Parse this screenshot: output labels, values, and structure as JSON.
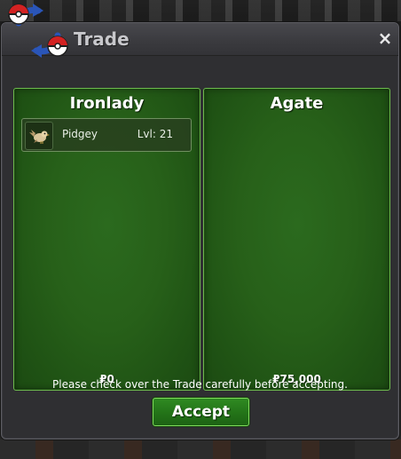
{
  "window": {
    "title": "Trade",
    "close_label": "×"
  },
  "trade": {
    "left": {
      "name": "Ironlady",
      "money": "₽0",
      "items": [
        {
          "name": "Pidgey",
          "level": "Lvl: 21",
          "icon": "pidgey-icon"
        }
      ]
    },
    "right": {
      "name": "Agate",
      "money": "₽75,000"
    }
  },
  "notice": "Please check over the Trade carefully before accepting.",
  "accept_label": "Accept",
  "colors": {
    "panel_green": "#276019",
    "panel_border": "#6dba4d",
    "accept_green": "#237318",
    "window_bg": "#2f2f32"
  }
}
